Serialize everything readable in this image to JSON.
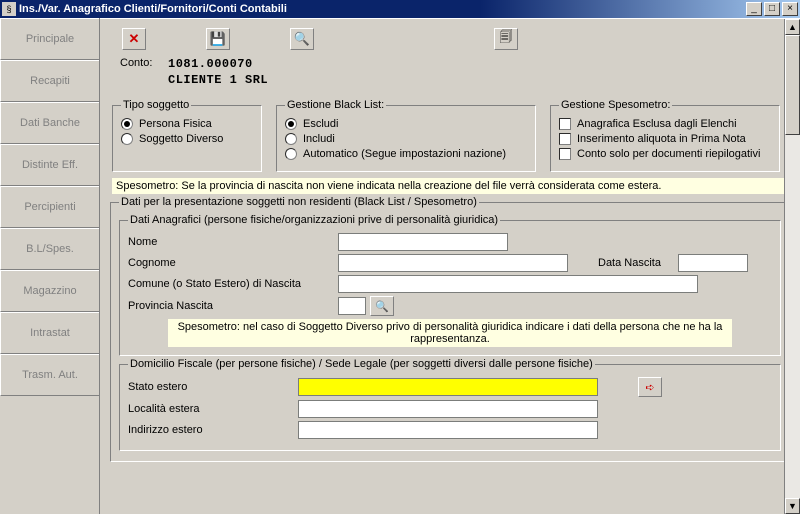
{
  "window": {
    "title": "Ins./Var. Anagrafico Clienti/Fornitori/Conti Contabili"
  },
  "tabs": {
    "principale": "Principale",
    "recapiti": "Recapiti",
    "datibanche": "Dati Banche",
    "distinte": "Distinte Eff.",
    "percipienti": "Percipienti",
    "blspes": "B.L/Spes.",
    "magazzino": "Magazzino",
    "intrastat": "Intrastat",
    "trasmaut": "Trasm. Aut."
  },
  "toolbar": {
    "close": "✕",
    "save": "💾",
    "search": "🔍",
    "print": "🗐"
  },
  "conto": {
    "label": "Conto:",
    "code": "1081.000070",
    "name": "CLIENTE 1 SRL"
  },
  "tipoSoggetto": {
    "legend": "Tipo soggetto",
    "fisica": "Persona Fisica",
    "diverso": "Soggetto Diverso"
  },
  "blacklist": {
    "legend": "Gestione Black List:",
    "escludi": "Escludi",
    "includi": "Includi",
    "auto": "Automatico (Segue impostazioni nazione)"
  },
  "spesometroG": {
    "legend": "Gestione Spesometro:",
    "esclusa": "Anagrafica Esclusa dagli Elenchi",
    "aliquota": "Inserimento aliquota in Prima Nota",
    "riepilog": "Conto solo per documenti riepilogativi"
  },
  "note1": "Spesometro: Se la provincia di nascita non viene indicata nella creazione del file verrà considerata come estera.",
  "dati": {
    "legend": "Dati per la presentazione soggetti non residenti (Black List / Spesometro)",
    "anag": {
      "legend": "Dati Anagrafici (persone fisiche/organizzazioni prive di personalità giuridica)",
      "nome_l": "Nome",
      "cognome_l": "Cognome",
      "datanascita_l": "Data Nascita",
      "comune_l": "Comune (o Stato Estero) di Nascita",
      "provincia_l": "Provincia Nascita",
      "nome": "",
      "cognome": "",
      "datanascita": "",
      "comune": "",
      "provincia": "",
      "note": "Spesometro: nel caso di Soggetto Diverso  privo di personalità giuridica indicare i dati della persona che ne ha la rappresentanza."
    },
    "dom": {
      "legend": "Domicilio Fiscale (per persone fisiche) / Sede Legale (per soggetti diversi dalle persone fisiche)",
      "stato_l": "Stato estero",
      "localita_l": "Località estera",
      "indirizzo_l": "Indirizzo estero",
      "stato": "",
      "localita": "",
      "indirizzo": ""
    }
  }
}
